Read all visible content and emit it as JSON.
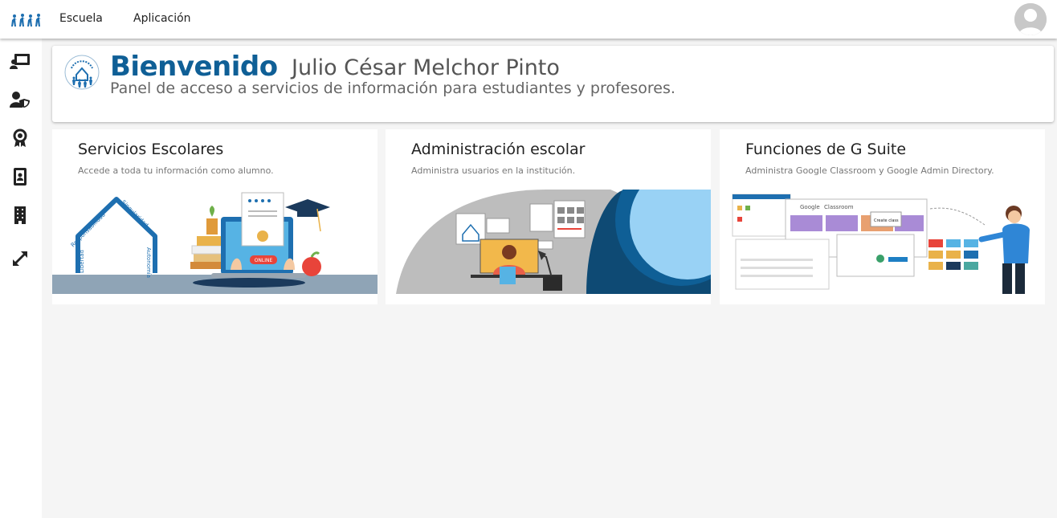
{
  "topbar": {
    "nav": [
      "Escuela",
      "Aplicación"
    ]
  },
  "sidebar": {
    "icons": [
      "presentation-icon",
      "user-shield-icon",
      "award-icon",
      "id-card-icon",
      "building-icon",
      "expand-icon"
    ]
  },
  "welcome": {
    "bold": "Bienvenido",
    "name": "Julio César Melchor Pinto",
    "subtitle": "Panel de acceso a servicios de información para estudiantes y profesores."
  },
  "cards": [
    {
      "title": "Servicios Escolares",
      "desc": "Accede a toda tu información como alumno.",
      "arch_words": [
        "Libertad",
        "Responsabilidad",
        "Singularidad",
        "Autonomía"
      ],
      "online_label": "ONLINE"
    },
    {
      "title": "Administración escolar",
      "desc": "Administra usuarios en la institución."
    },
    {
      "title": "Funciones de G Suite",
      "desc": "Administra Google Classroom y Google Admin Directory.",
      "classroom_label": "Google Classroom",
      "google_label": "Google",
      "classroom_word": "Classroom",
      "create_class": "Create class"
    }
  ],
  "colors": {
    "brand_blue": "#0f5f96",
    "accent_blue": "#1e7fc4"
  }
}
